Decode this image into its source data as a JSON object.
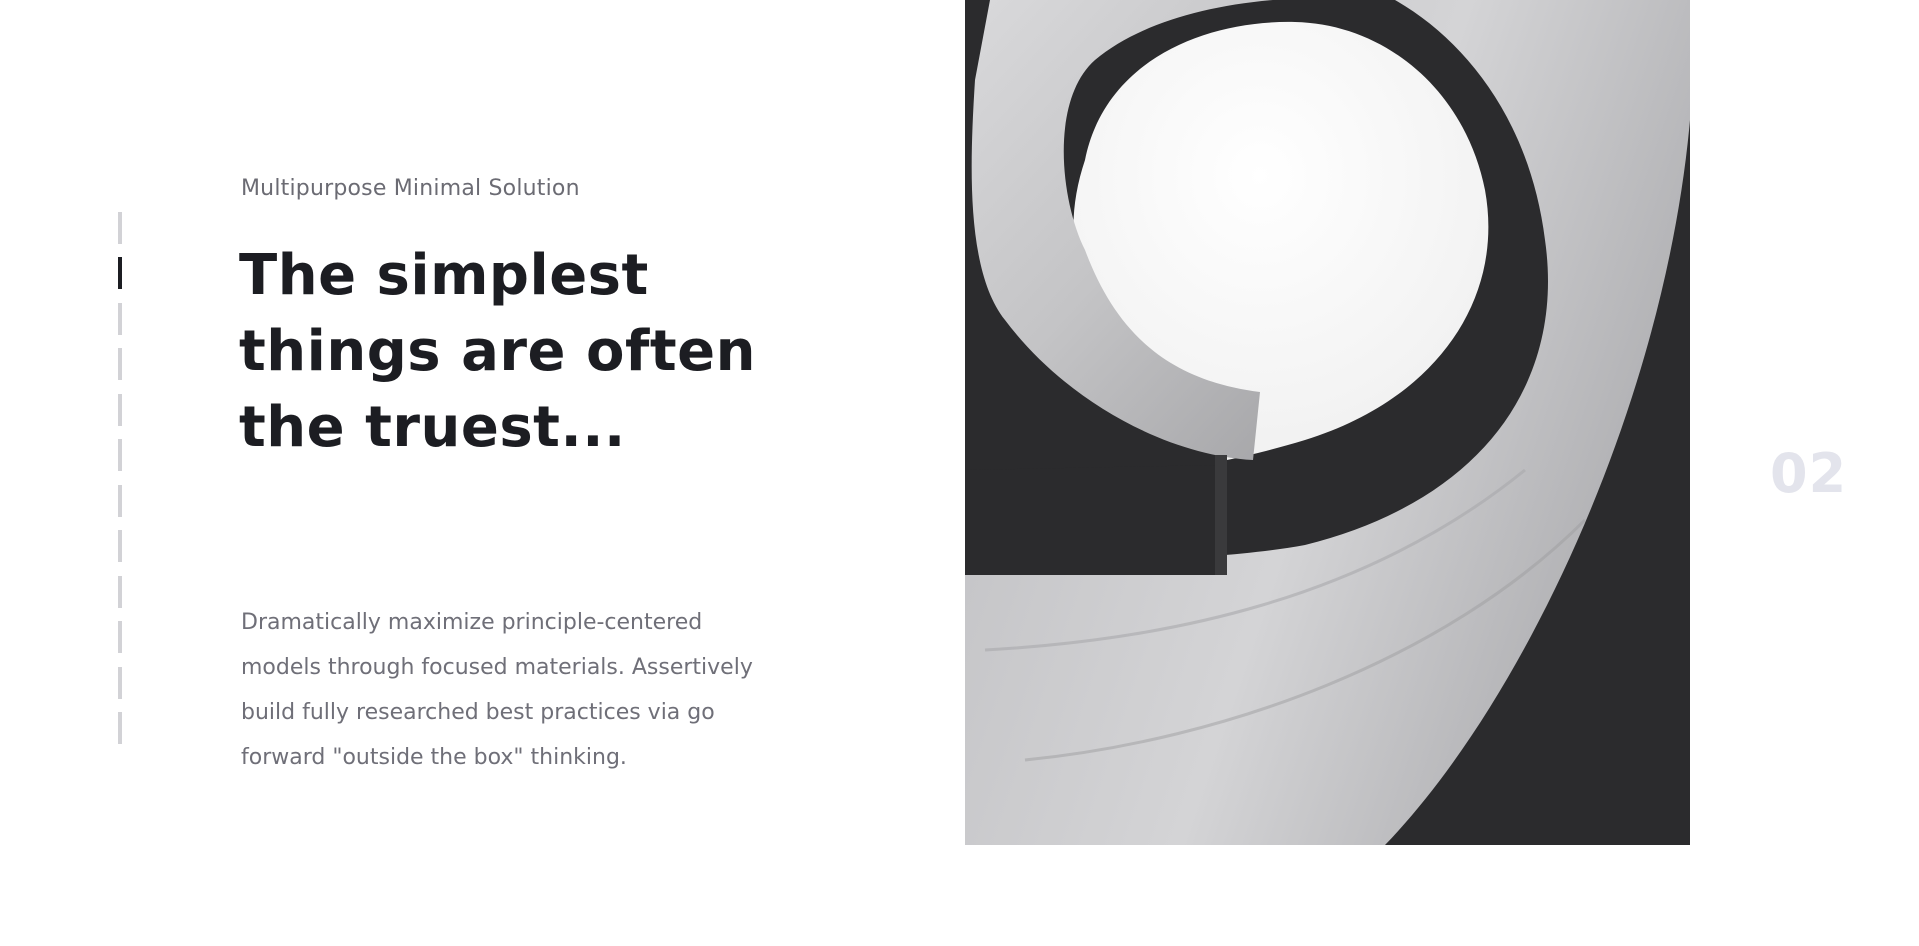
{
  "slide": {
    "subtitle": "Multipurpose Minimal Solution",
    "headline_lines": [
      "The simplest",
      "things are often",
      "the truest..."
    ],
    "body_lines": [
      "Dramatically maximize principle-centered",
      "models through focused materials. Assertively",
      "build fully researched best practices via go",
      "forward \"outside the box\" thinking."
    ],
    "number": "02",
    "image_icon": "spiral-sculpture-image"
  },
  "pagination": {
    "count": 12,
    "active_index": 1,
    "active_color": "#1c1d22",
    "inactive_color": "#d2d2d6"
  }
}
